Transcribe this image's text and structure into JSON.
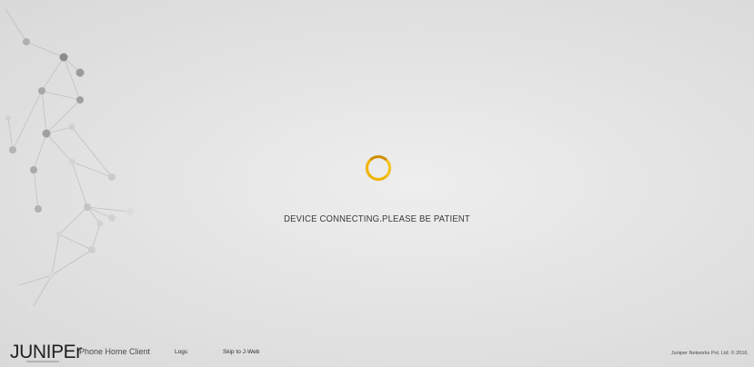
{
  "status": {
    "message": "DEVICE CONNECTING.PLEASE BE PATIENT"
  },
  "spinner": {
    "color": "#f0b400",
    "icon": "loading-spinner-icon"
  },
  "footer": {
    "logo_text": "JUNIPEr",
    "app_name": "Phone Home Client",
    "links": {
      "logs": "Logs",
      "skip": "Skip to J-Web"
    },
    "copyright": "Juniper Networks Pvt. Ltd. © 2016."
  },
  "background": {
    "color": "#e6e6e6",
    "decoration_icon": "network-nodes-graphic"
  }
}
